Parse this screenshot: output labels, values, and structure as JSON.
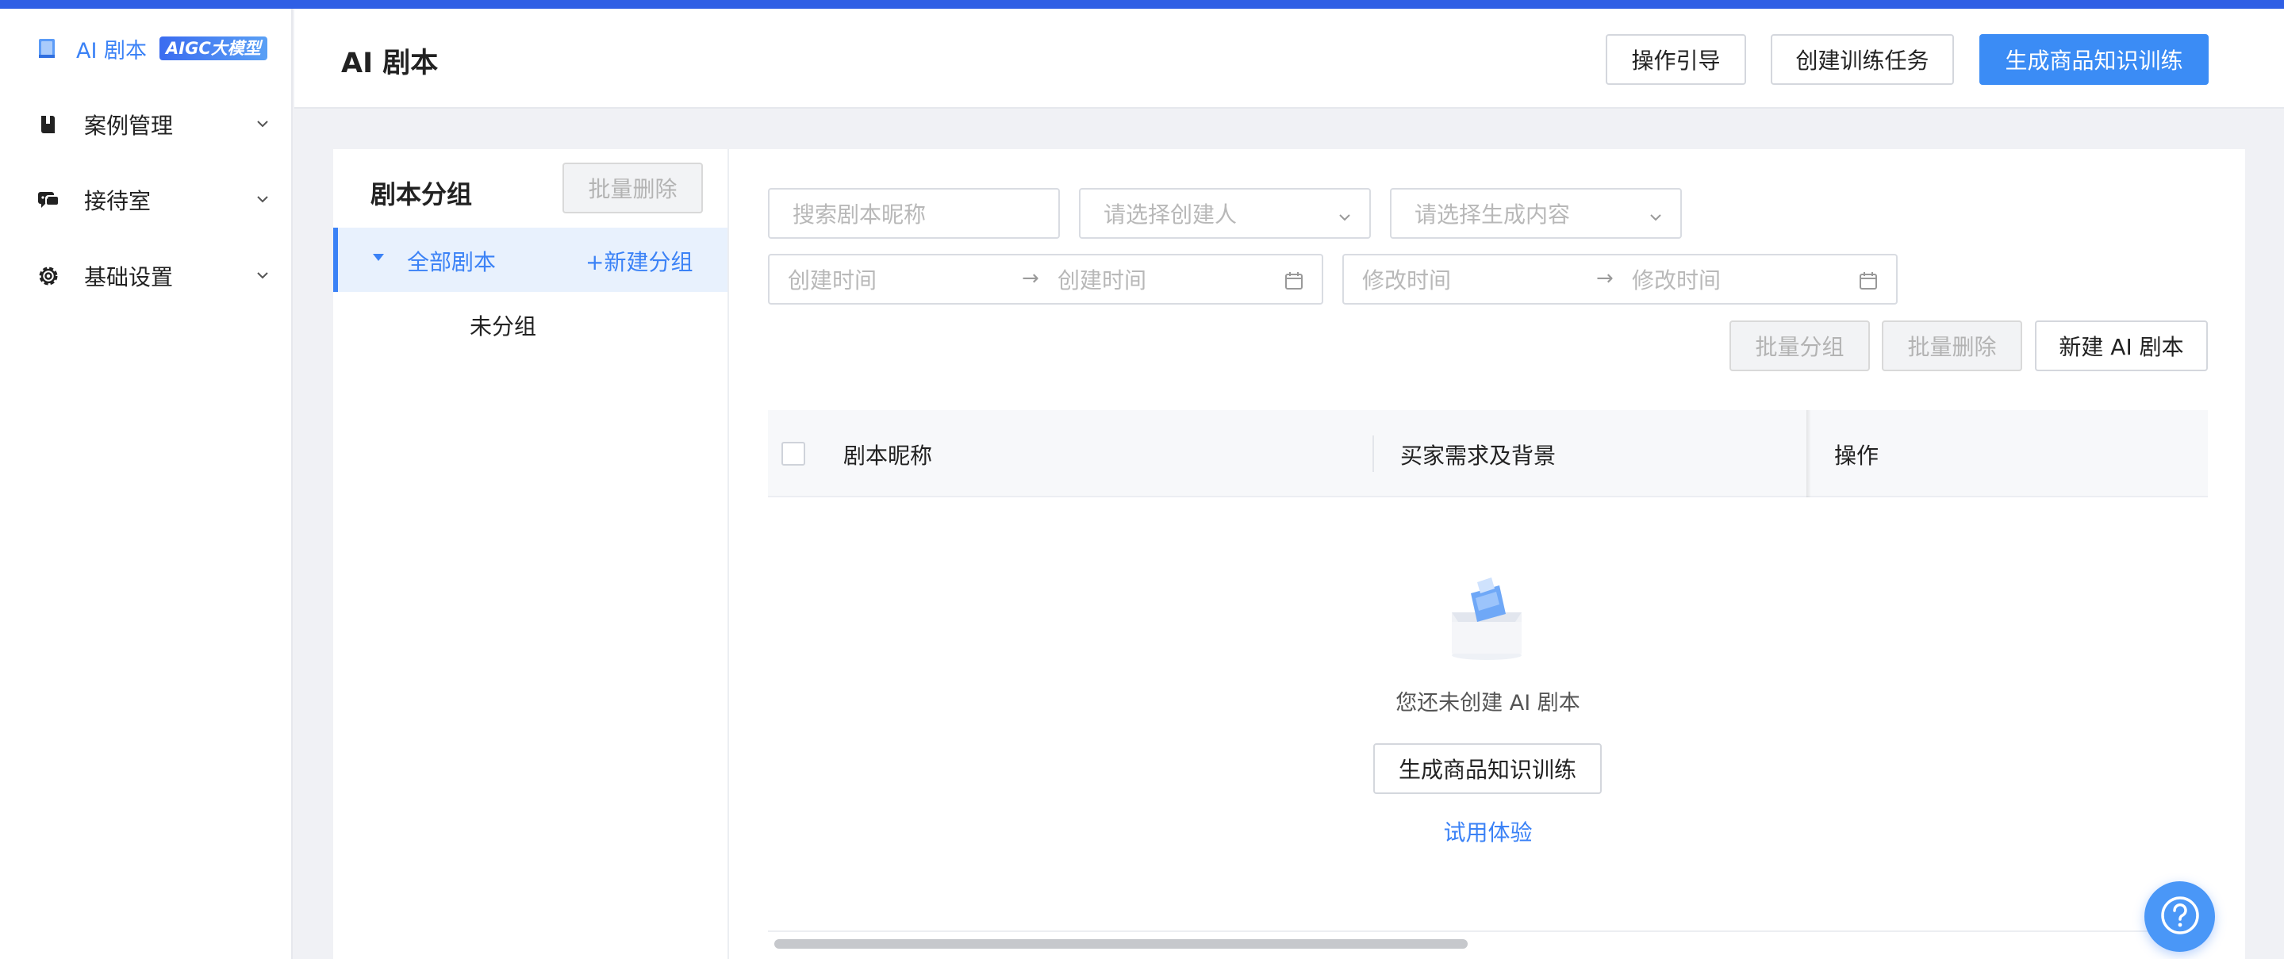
{
  "brand": {
    "title": "AI 剧本",
    "badge": "AIGC大模型",
    "accent": "#3b82f6"
  },
  "sidebar": {
    "items": [
      {
        "label": "案例管理",
        "icon": "book-icon"
      },
      {
        "label": "接待室",
        "icon": "chat-bubbles-icon"
      },
      {
        "label": "基础设置",
        "icon": "gear-icon"
      }
    ]
  },
  "header": {
    "title": "AI 剧本",
    "buttons": {
      "guide": "操作引导",
      "create_task": "创建训练任务",
      "generate": "生成商品知识训练"
    }
  },
  "groups": {
    "title": "剧本分组",
    "batch_delete": "批量删除",
    "all_label": "全部剧本",
    "new_group": "+新建分组",
    "ungrouped": "未分组"
  },
  "filters": {
    "search_placeholder": "搜索剧本昵称",
    "creator_placeholder": "请选择创建人",
    "content_placeholder": "请选择生成内容",
    "create_start": "创建时间",
    "create_end": "创建时间",
    "modify_start": "修改时间",
    "modify_end": "修改时间",
    "arrow": "→"
  },
  "actions": {
    "batch_group": "批量分组",
    "batch_delete": "批量删除",
    "new_script": "新建 AI 剧本"
  },
  "table": {
    "columns": [
      "剧本昵称",
      "买家需求及背景",
      "操作"
    ]
  },
  "empty": {
    "message": "您还未创建 AI 剧本",
    "button": "生成商品知识训练",
    "link": "试用体验"
  },
  "help": {
    "icon": "question-icon",
    "glyph": "?"
  }
}
